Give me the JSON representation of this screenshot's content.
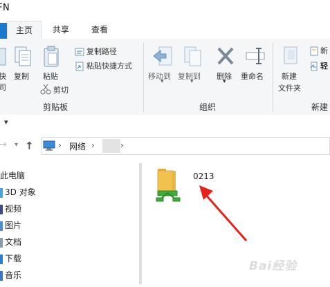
{
  "window": {
    "title": "FN"
  },
  "tabs": [
    {
      "label": "主页"
    },
    {
      "label": "共享"
    },
    {
      "label": "查看"
    }
  ],
  "ribbon": {
    "clipboard": {
      "pin_label_partial_1": "快",
      "pin_label_partial_2": "司",
      "copy": "复制",
      "paste": "粘贴",
      "copy_path": "复制路径",
      "paste_shortcut": "粘贴快捷方式",
      "cut": "剪切",
      "group": "剪贴板"
    },
    "organize": {
      "move_to": "移动到",
      "copy_to": "复制到",
      "delete": "删除",
      "rename": "重命名",
      "group": "组织"
    },
    "new": {
      "new_folder_line1": "新建",
      "new_folder_line2": "文件夹",
      "new_item_partial": "新",
      "easy_access_partial": "轻",
      "group": "新建"
    }
  },
  "qat": {
    "dropdown_glyph": "▾"
  },
  "address": {
    "segments": [
      "网络"
    ],
    "separator": "›"
  },
  "nav_pane": {
    "items": [
      {
        "label": "此电脑",
        "icon": "computer-icon"
      },
      {
        "label": "3D 对象",
        "icon": "3d-objects-icon"
      },
      {
        "label": "视频",
        "icon": "video-folder-icon"
      },
      {
        "label": "图片",
        "icon": "pictures-folder-icon"
      },
      {
        "label": "文档",
        "icon": "documents-folder-icon"
      },
      {
        "label": "下载",
        "icon": "downloads-folder-icon"
      },
      {
        "label": "音乐",
        "icon": "music-folder-icon"
      }
    ]
  },
  "content": {
    "items": [
      {
        "name": "0213",
        "icon": "shared-folder-icon"
      }
    ]
  },
  "watermark": "Bai经验",
  "colors": {
    "accent": "#1979ca",
    "annotation_arrow": "#e8201a",
    "ribbon_bg": "#f5f6f7",
    "folder": "#f2c24f",
    "share_green": "#3fa93a"
  }
}
